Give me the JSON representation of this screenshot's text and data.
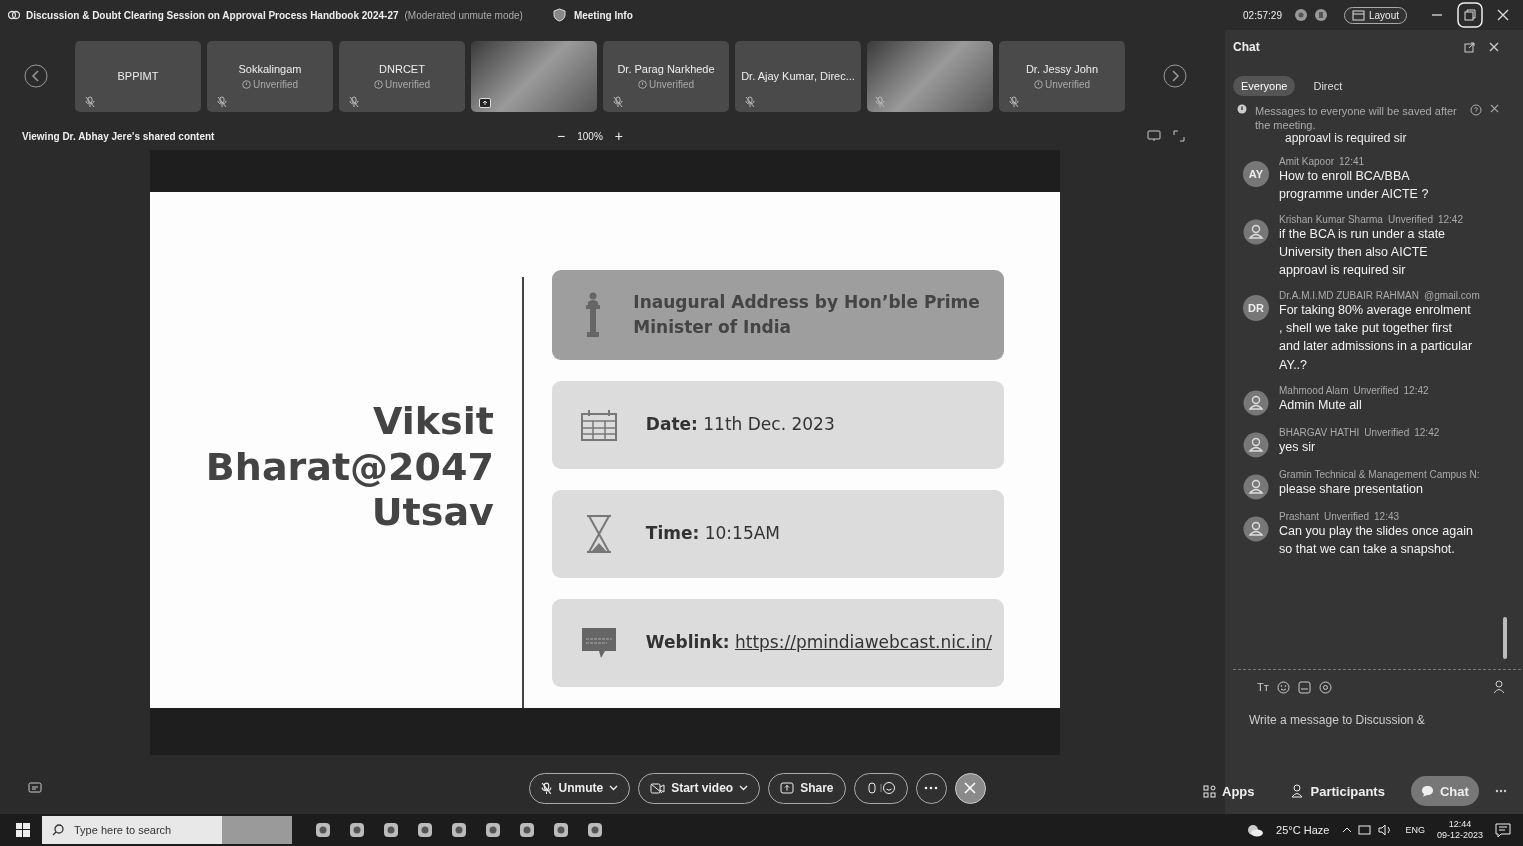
{
  "window": {
    "title": "Discussion & Doubt Clearing Session on Approval Process Handbook 2024-27",
    "mode": "(Moderated unmute mode)",
    "meeting_info": "Meeting Info",
    "clock": "02:57:29",
    "layout_button": "Layout"
  },
  "participants": [
    {
      "kind": "name",
      "name": "BPPIMT",
      "muted": true
    },
    {
      "kind": "name",
      "name": "Sokkalingam",
      "status": "Unverified",
      "muted": true
    },
    {
      "kind": "name",
      "name": "DNRCET",
      "status": "Unverified",
      "muted": true
    },
    {
      "kind": "video",
      "muted": false,
      "sharing": true
    },
    {
      "kind": "name",
      "name": "Dr. Parag Narkhede",
      "status": "Unverified",
      "muted": true
    },
    {
      "kind": "name",
      "name": "Dr. Ajay Kumar, Direc...",
      "muted": true
    },
    {
      "kind": "video",
      "muted": true,
      "sharing": false
    },
    {
      "kind": "name",
      "name": "Dr. Jessy John",
      "status": "Unverified",
      "muted": true
    }
  ],
  "viewing": {
    "label": "Viewing Dr. Abhay Jere's shared content",
    "zoom": "100%",
    "zoom_out": "−",
    "zoom_in": "+"
  },
  "slide": {
    "title_lines": [
      "Viksit",
      "Bharat@2047",
      "Utsav"
    ],
    "cards": [
      {
        "kind": "text",
        "emphasis": true,
        "text": "Inaugural Address by Hon’ble Prime Minister of India"
      },
      {
        "kind": "text",
        "emphasis": false,
        "text": "**Date:** 11th Dec. 2023"
      },
      {
        "kind": "text",
        "emphasis": false,
        "text": "**Time:** 10:15AM"
      },
      {
        "kind": "link",
        "emphasis": false,
        "label": "Weblink:",
        "link": "https://pmindiawebcast.nic.in/"
      }
    ]
  },
  "controls": [
    {
      "kind": "mic",
      "label": "Unmute",
      "caret": true
    },
    {
      "kind": "video",
      "label": "Start video",
      "caret": true
    },
    {
      "kind": "share",
      "label": "Share",
      "caret": false
    }
  ],
  "side_controls": [
    {
      "kind": "apps",
      "label": "Apps",
      "selected": false
    },
    {
      "kind": "participants",
      "label": "Participants",
      "selected": false
    },
    {
      "kind": "chat",
      "label": "Chat",
      "selected": true
    }
  ],
  "chat": {
    "title": "Chat",
    "tabs": [
      {
        "label": "Everyone",
        "selected": true
      },
      {
        "label": "Direct",
        "selected": false
      }
    ],
    "notice": "Messages to everyone will be saved after the meeting.",
    "partial_text": "approavl is required sir",
    "messages": [
      {
        "initials": "AY",
        "name": "Amit Kapoor",
        "time": "12:41",
        "text": "How to enroll BCA/BBA programme under AICTE ?"
      },
      {
        "name": "Krishan Kumar Sharma",
        "status": "Unverified",
        "time": "12:42",
        "text": "if the BCA is run under a state University then also AICTE approavl is required sir"
      },
      {
        "initials": "DR",
        "name": "Dr.A.M.I.MD ZUBAIR RAHMAN",
        "status": "@gmail.com",
        "text": "For taking 80% average enrolment , shell we take put together first and later admissions in a particular AY..?"
      },
      {
        "name": "Mahmood Alam",
        "status": "Unverified",
        "time": "12:42",
        "text": "Admin Mute all"
      },
      {
        "name": "BHARGAV HATHI",
        "status": "Unverified",
        "time": "12:42",
        "text": "yes sir"
      },
      {
        "name": "Gramin Technical & Management Campus N:",
        "text": "please share presentation"
      },
      {
        "name": "Prashant",
        "status": "Unverified",
        "time": "12:43",
        "text": "Can you play the slides once again so that we can take a snapshot."
      }
    ],
    "format_icon": "Tт",
    "placeholder": "Write a message to Discussion &"
  },
  "taskbar": {
    "search_placeholder": "Type here to search",
    "weather": "25°C Haze",
    "language": "ENG",
    "time": "12:44",
    "date": "09-12-2023"
  }
}
